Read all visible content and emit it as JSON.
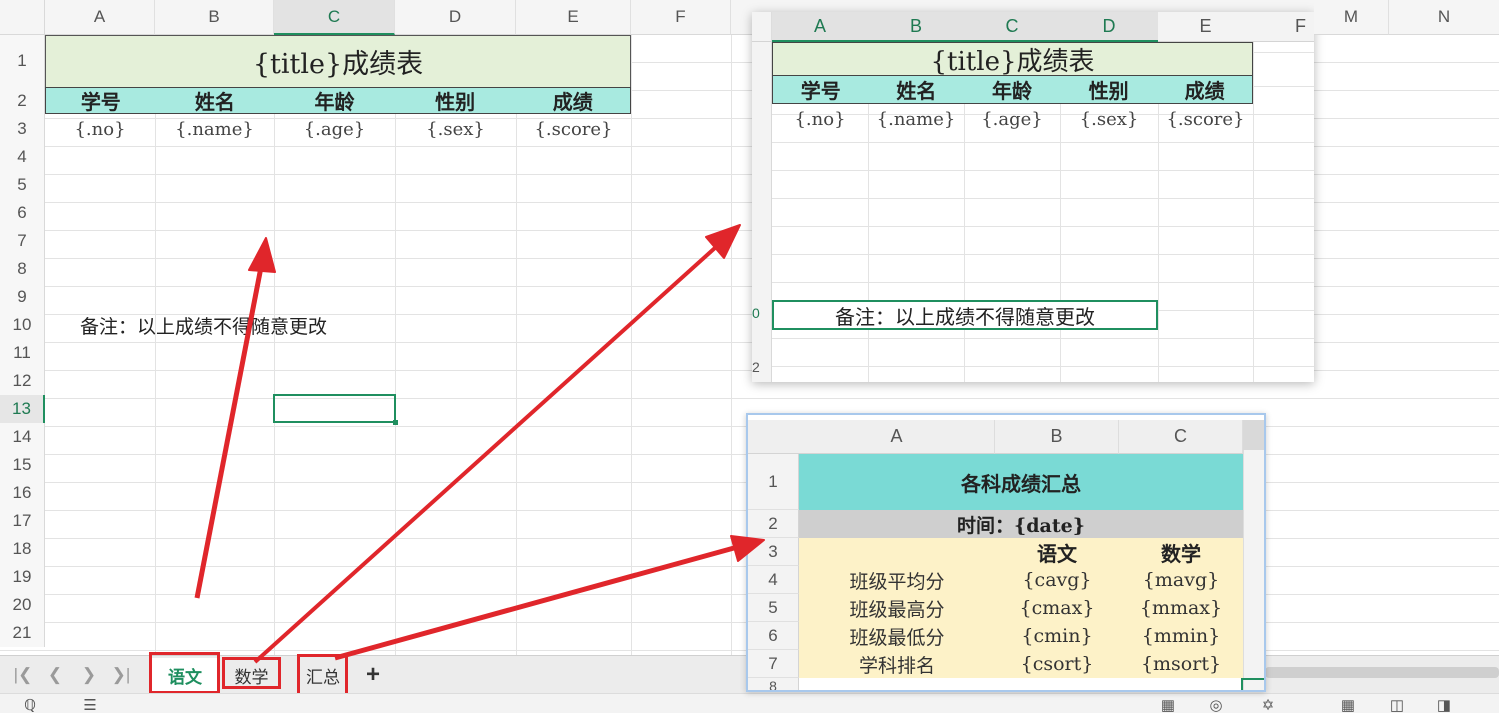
{
  "main_sheet": {
    "columns": [
      "A",
      "B",
      "C",
      "D",
      "E",
      "F"
    ],
    "selected_column": "C",
    "rows": [
      "1",
      "2",
      "3",
      "4",
      "5",
      "6",
      "7",
      "8",
      "9",
      "10",
      "11",
      "12",
      "13",
      "14",
      "15",
      "16",
      "17",
      "18",
      "19",
      "20",
      "21"
    ],
    "selected_row": "13",
    "title": "{title}成绩表",
    "headers": [
      "学号",
      "姓名",
      "年龄",
      "性别",
      "成绩"
    ],
    "placeholders": [
      "{.no}",
      "{.name}",
      "{.age}",
      "{.sex}",
      "{.score}"
    ],
    "note": "备注：以上成绩不得随意更改",
    "title_bg": "#e4f0d8",
    "header_bg": "#a8eae0"
  },
  "preview_chinese": {
    "columns": [
      "A",
      "B",
      "C",
      "D",
      "E",
      "F",
      "M",
      "N"
    ],
    "title": "{title}成绩表",
    "headers": [
      "学号",
      "姓名",
      "年龄",
      "性别",
      "成绩"
    ],
    "placeholders": [
      "{.no}",
      "{.name}",
      "{.age}",
      "{.sex}",
      "{.score}"
    ],
    "note": "备注：以上成绩不得随意更改",
    "row_fragments": [
      "0",
      "2"
    ]
  },
  "preview_summary": {
    "columns": [
      "A",
      "B",
      "C"
    ],
    "rows": [
      "1",
      "2",
      "3",
      "4",
      "5",
      "6",
      "7",
      "8"
    ],
    "title": "各科成绩汇总",
    "time": "时间：{date}",
    "subject_headers": [
      "语文",
      "数学"
    ],
    "stats": [
      {
        "label": "班级平均分",
        "chinese": "{cavg}",
        "math": "{mavg}"
      },
      {
        "label": "班级最高分",
        "chinese": "{cmax}",
        "math": "{mmax}"
      },
      {
        "label": "班级最低分",
        "chinese": "{cmin}",
        "math": "{mmin}"
      },
      {
        "label": "学科排名",
        "chinese": "{csort}",
        "math": "{msort}"
      }
    ],
    "title_bg": "#7adad5",
    "time_bg": "#cfcfcf",
    "body_bg": "#fdf2c8"
  },
  "tabs": {
    "items": [
      "语文",
      "数学",
      "汇总"
    ],
    "active": "语文",
    "add_label": "+",
    "nav": [
      "first-sheet-icon",
      "prev-sheet-icon",
      "next-sheet-icon",
      "last-sheet-icon"
    ]
  },
  "annotation": {
    "arrow_color": "#e0262b",
    "box_color": "#e0262b"
  }
}
